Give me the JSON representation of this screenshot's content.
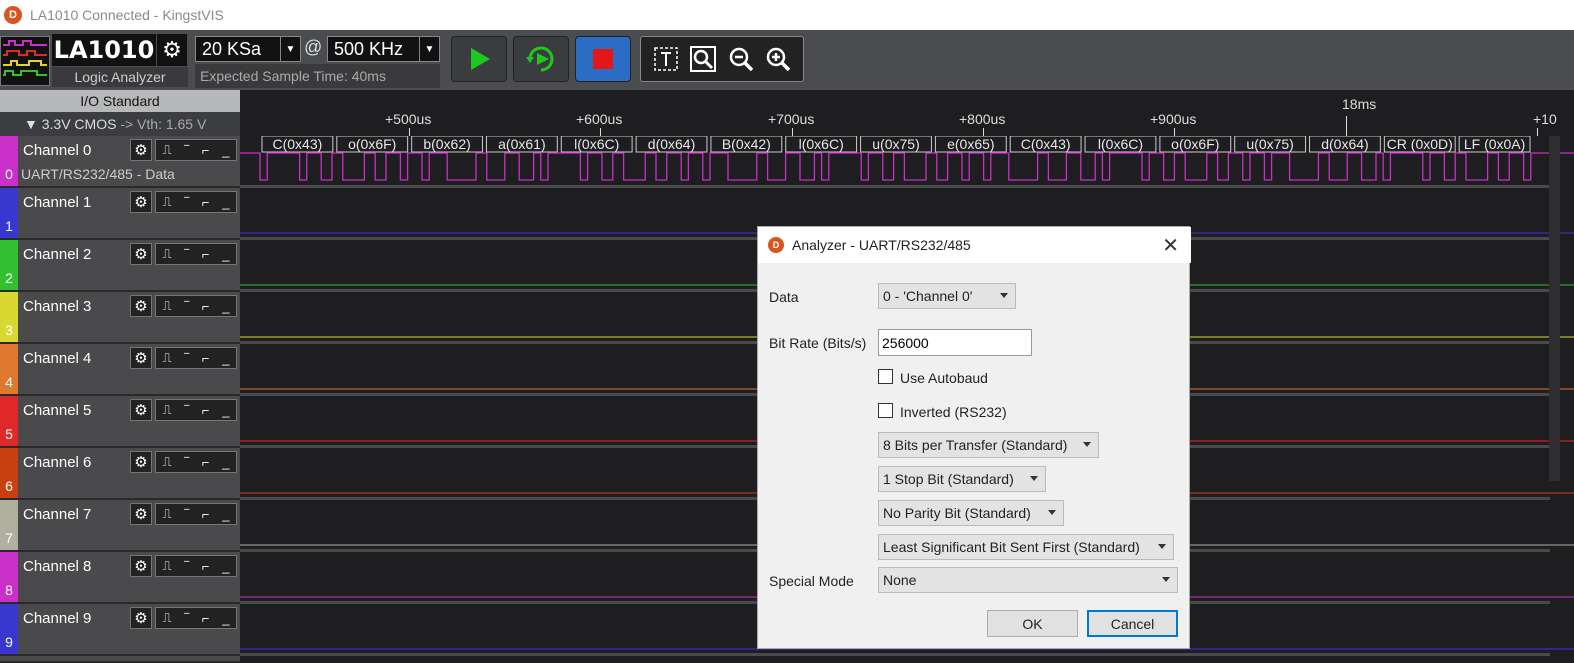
{
  "window": {
    "title": "LA1010 Connected - KingstVIS"
  },
  "device": {
    "name": "LA1010",
    "subtitle": "Logic Analyzer"
  },
  "sampling": {
    "depth": "20 KSa",
    "at": "@",
    "rate": "500 KHz",
    "expected": "Expected Sample Time: 40ms"
  },
  "io": {
    "header": "I/O Standard",
    "standard": "▼ 3.3V CMOS",
    "vth": "-> Vth: 1.65 V"
  },
  "ruler": {
    "ticks": [
      "+500us",
      "+600us",
      "+700us",
      "+800us",
      "+900us",
      "+10"
    ],
    "marker": "18ms"
  },
  "decoded": [
    "C(0x43)",
    "o(0x6F)",
    "b(0x62)",
    "a(0x61)",
    "l(0x6C)",
    "d(0x64)",
    "B(0x42)",
    "l(0x6C)",
    "u(0x75)",
    "e(0x65)",
    "C(0x43)",
    "l(0x6C)",
    "o(0x6F)",
    "u(0x75)",
    "d(0x64)",
    "CR (0x0D)",
    "LF (0x0A)"
  ],
  "channels": [
    {
      "num": "0",
      "name": "Channel 0",
      "sub": "UART/RS232/485 - Data",
      "color": "#c830c8"
    },
    {
      "num": "1",
      "name": "Channel 1",
      "color": "#3838d0"
    },
    {
      "num": "2",
      "name": "Channel 2",
      "color": "#30c030"
    },
    {
      "num": "3",
      "name": "Channel 3",
      "color": "#d8d830"
    },
    {
      "num": "4",
      "name": "Channel 4",
      "color": "#e07830"
    },
    {
      "num": "5",
      "name": "Channel 5",
      "color": "#e02828"
    },
    {
      "num": "6",
      "name": "Channel 6",
      "color": "#c84010"
    },
    {
      "num": "7",
      "name": "Channel 7",
      "color": "#b0b0a0"
    },
    {
      "num": "8",
      "name": "Channel 8",
      "color": "#c830c8"
    },
    {
      "num": "9",
      "name": "Channel 9",
      "color": "#3838d0"
    }
  ],
  "dialog": {
    "title": "Analyzer - UART/RS232/485",
    "close": "✕",
    "data_label": "Data",
    "data_value": "0 - 'Channel 0'",
    "bitrate_label": "Bit Rate (Bits/s)",
    "bitrate_value": "256000",
    "autobaud": "Use Autobaud",
    "inverted": "Inverted (RS232)",
    "bits": "8 Bits per Transfer (Standard)",
    "stop": "1 Stop Bit (Standard)",
    "parity": "No Parity Bit (Standard)",
    "order": "Least Significant Bit Sent First (Standard)",
    "special_label": "Special Mode",
    "special_value": "None",
    "ok": "OK",
    "cancel": "Cancel"
  },
  "icons": {
    "gear": "gear-icon",
    "run": "play-icon",
    "loop": "loop-run-icon",
    "stop": "stop-icon",
    "text": "text-cursor-icon",
    "zoomfit": "zoom-fit-icon",
    "zoomout": "zoom-out-icon",
    "zoomin": "zoom-in-icon"
  },
  "colors": {
    "accent": "#d9541e",
    "play": "#1ec81e",
    "stop": "#e01818",
    "stop_bg": "#2b6cc4"
  }
}
